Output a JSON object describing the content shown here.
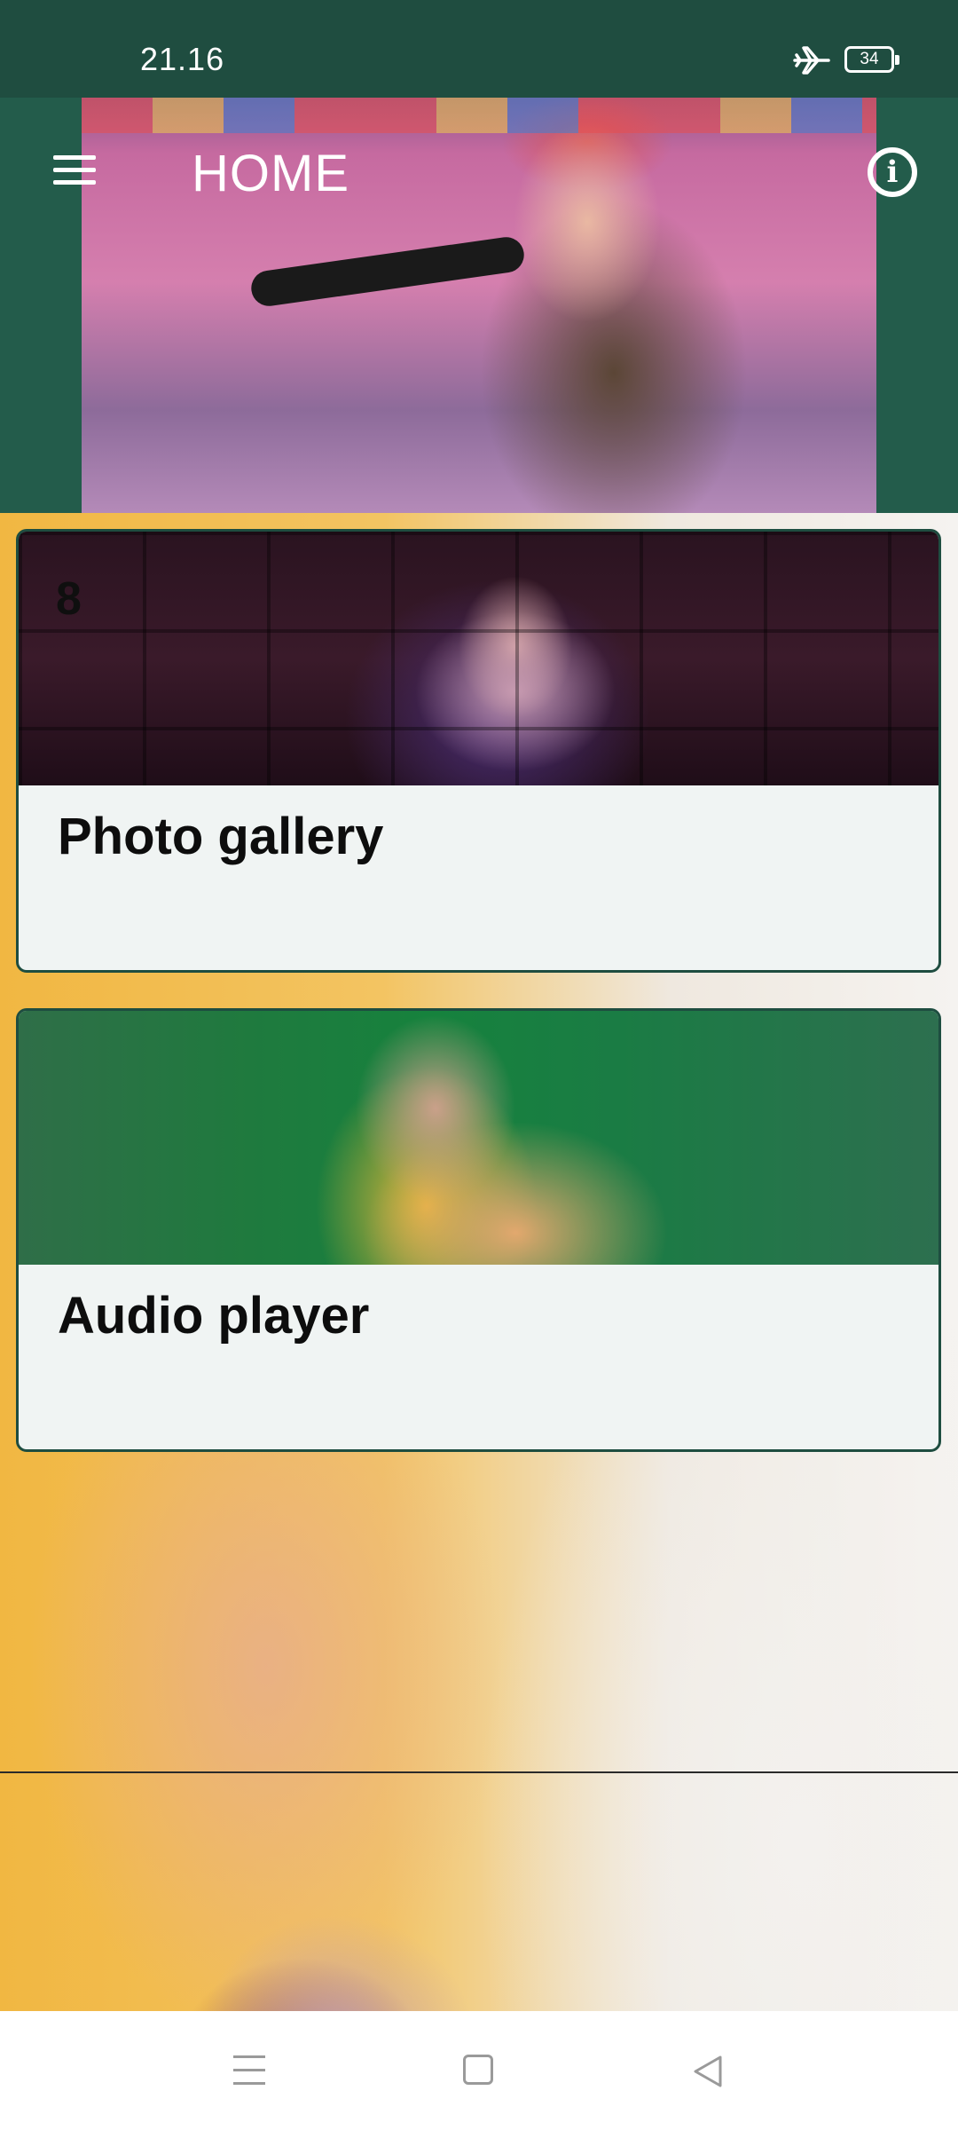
{
  "status_bar": {
    "time": "21.16",
    "battery_level": "34",
    "icons": [
      "airplane-icon",
      "battery-icon"
    ]
  },
  "header": {
    "title": "HOME",
    "menu_icon": "menu-icon",
    "info_icon": "info-icon"
  },
  "cards": [
    {
      "title": "Photo gallery",
      "badge": "8",
      "image": "singer-performing-photo"
    },
    {
      "title": "Audio player",
      "image": "green-door-portrait-photo"
    }
  ],
  "nav_bar": {
    "icons": [
      "nav-recents-icon",
      "nav-home-icon",
      "nav-back-icon"
    ]
  },
  "colors": {
    "header_green": "#235c4b",
    "status_green": "#1f4d40",
    "card_background": "#f0f4f3",
    "card_border": "#1e4d40"
  }
}
